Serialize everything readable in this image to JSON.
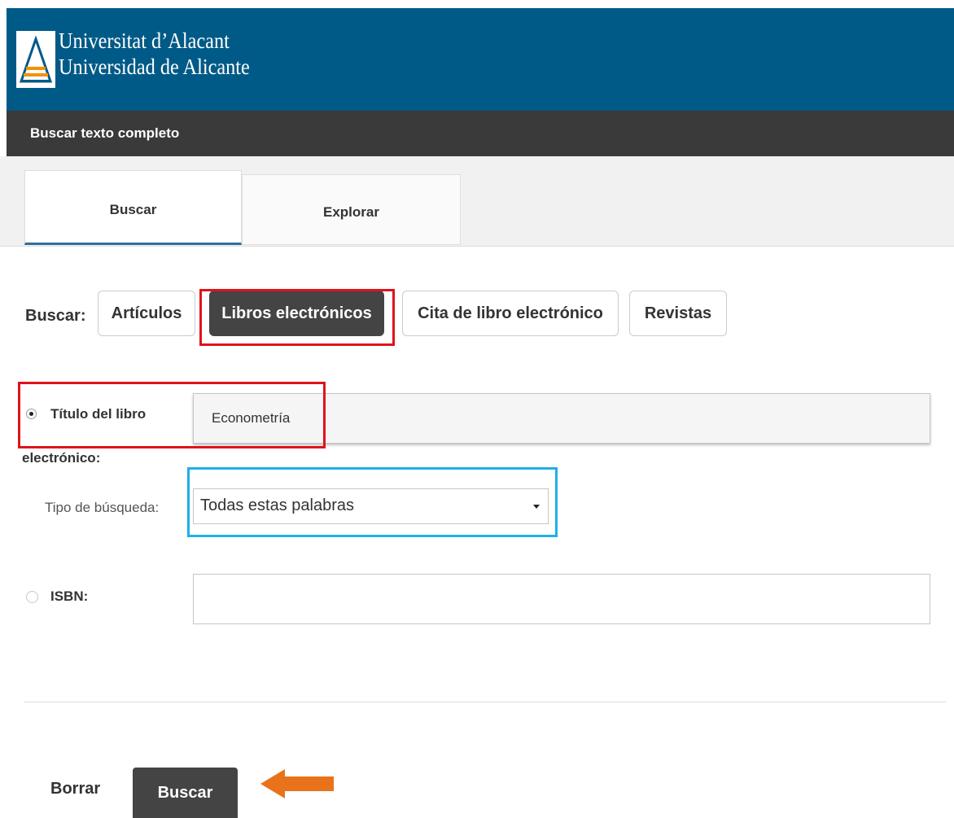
{
  "header": {
    "university_line1": "Universitat d’Alacant",
    "university_line2": "Universidad de Alicante",
    "logo_icon": "university-logo-icon"
  },
  "section_bar": {
    "title": "Buscar texto completo"
  },
  "tabs": [
    {
      "label": "Buscar",
      "active": true
    },
    {
      "label": "Explorar",
      "active": false
    }
  ],
  "search_type": {
    "label": "Buscar:",
    "options": [
      {
        "label": "Artículos",
        "active": false
      },
      {
        "label": "Libros electrónicos",
        "active": true
      },
      {
        "label": "Cita de libro electrónico",
        "active": false
      },
      {
        "label": "Revistas",
        "active": false
      }
    ]
  },
  "form": {
    "title_field": {
      "label_line1": "Título del libro",
      "label_line2": "electrónico:",
      "value": "Econometría",
      "selected": true
    },
    "search_mode": {
      "label": "Tipo de búsqueda:",
      "selected_value": "Todas estas palabras"
    },
    "isbn_field": {
      "label": "ISBN:",
      "value": "",
      "selected": false
    }
  },
  "actions": {
    "clear_label": "Borrar",
    "submit_label": "Buscar"
  },
  "colors": {
    "header_bg": "#005a87",
    "section_bar_bg": "#3a3a3a",
    "active_button_bg": "#444444",
    "annotation_red": "#e0131b",
    "annotation_blue": "#1fb0e6",
    "annotation_arrow": "#e8731a"
  }
}
